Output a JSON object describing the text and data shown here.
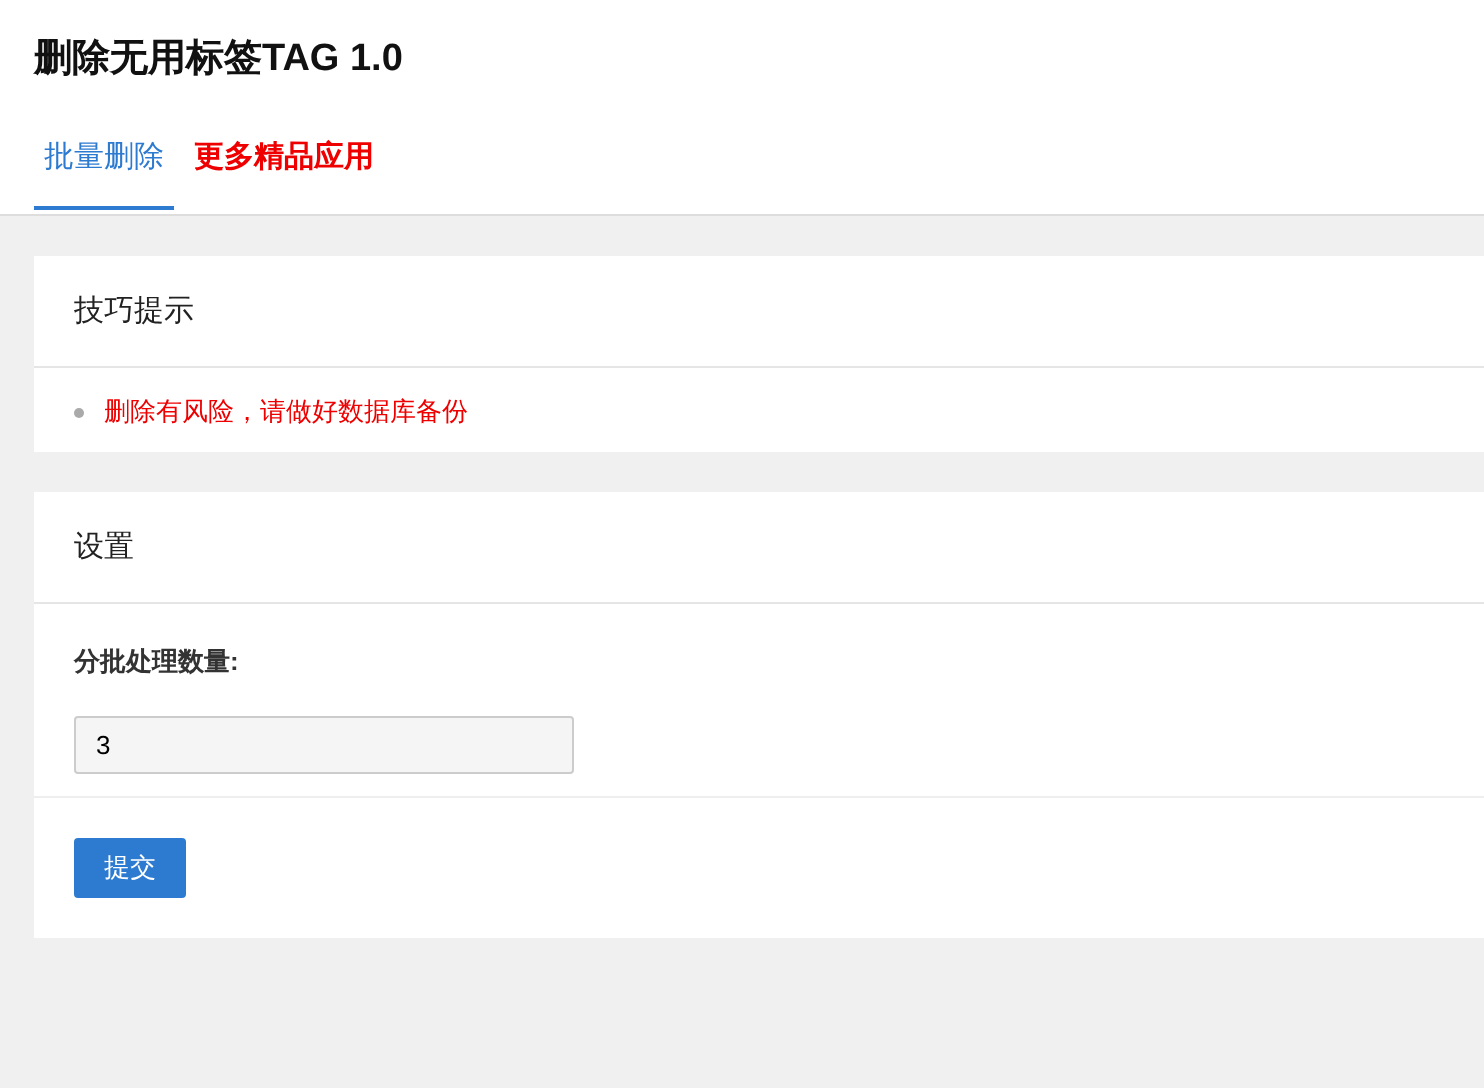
{
  "title": "删除无用标签TAG 1.0",
  "tabs": [
    {
      "label": "批量删除",
      "selected": true,
      "kind": "tab"
    },
    {
      "label": "更多精品应用",
      "selected": false,
      "kind": "promo"
    }
  ],
  "tips": {
    "title": "技巧提示",
    "items": [
      "删除有风险，请做好数据库备份"
    ]
  },
  "settings": {
    "title": "设置",
    "field_label": "分批处理数量:",
    "field_value": "3",
    "submit": "提交"
  }
}
